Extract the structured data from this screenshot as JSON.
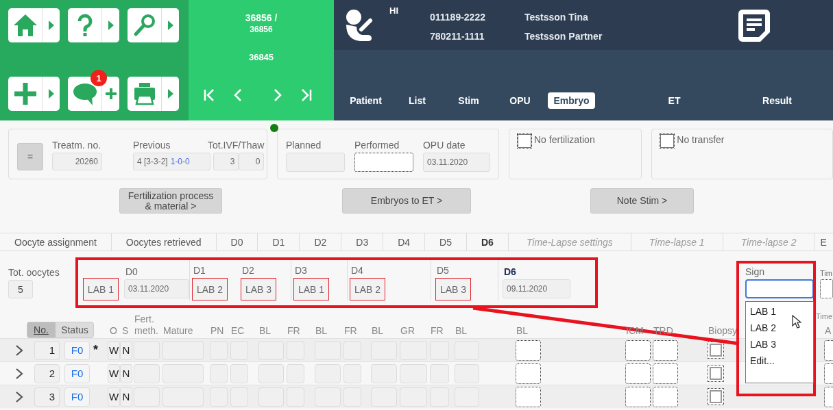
{
  "toolbar": {
    "buttons": [
      {
        "kind": "home",
        "has_menu": true,
        "quick_add": false
      },
      {
        "kind": "help",
        "has_menu": true,
        "quick_add": false
      },
      {
        "kind": "search",
        "has_menu": true,
        "quick_add": false
      },
      {
        "kind": "add",
        "has_menu": true,
        "quick_add": false
      },
      {
        "kind": "comment",
        "has_menu": false,
        "quick_add": true,
        "badge": "1"
      },
      {
        "kind": "print",
        "has_menu": true,
        "quick_add": false
      }
    ]
  },
  "record": {
    "current": "36856 /",
    "total": "36856",
    "previous": "36845",
    "nav": [
      {
        "kind": "first"
      },
      {
        "kind": "prev"
      },
      {
        "kind": "next"
      },
      {
        "kind": "last"
      }
    ]
  },
  "patient": {
    "badge": "HI",
    "people": [
      {
        "id": "011189-2222",
        "name": "Testsson Tina"
      },
      {
        "id": "780211-1111",
        "name": "Testsson Partner"
      }
    ]
  },
  "main_tabs": [
    {
      "label": "Patient",
      "selected": false
    },
    {
      "label": "List",
      "selected": false
    },
    {
      "label": "Stim",
      "selected": false
    },
    {
      "label": "OPU",
      "selected": false
    },
    {
      "label": "Embryo",
      "selected": true
    },
    {
      "label": "ET",
      "selected": false
    },
    {
      "label": "Result",
      "selected": false
    }
  ],
  "treatment": {
    "button": "=",
    "treatment_no": {
      "label": "Treatm. no.",
      "value": "20260"
    },
    "previous": {
      "label": "Previous",
      "value": "4 [3-3-2]",
      "outcome": "1-0-0"
    },
    "tot_ivf_thaw": {
      "label": "Tot.IVF/Thaw",
      "ivf": "3",
      "thaw": "0"
    }
  },
  "opu": [
    {
      "label": "Planned",
      "focused": false
    },
    {
      "label": "Performed",
      "focused": true
    },
    {
      "label": "OPU date",
      "value": "03.11.2020",
      "focused": false
    }
  ],
  "options": [
    {
      "label": "No fertilization",
      "checked": false
    },
    {
      "label": "No transfer",
      "checked": false
    }
  ],
  "actions": [
    "Fertilization process & material >",
    "Embryos to ET >",
    "Note Stim >"
  ],
  "sections": [
    {
      "label": "Oocyte assignment",
      "selected": false,
      "disabled": false
    },
    {
      "label": "Oocytes retrieved",
      "selected": false,
      "disabled": false
    },
    {
      "label": "D0",
      "selected": false,
      "disabled": false
    },
    {
      "label": "D1",
      "selected": false,
      "disabled": false
    },
    {
      "label": "D2",
      "selected": false,
      "disabled": false
    },
    {
      "label": "D3",
      "selected": false,
      "disabled": false
    },
    {
      "label": "D4",
      "selected": false,
      "disabled": false
    },
    {
      "label": "D5",
      "selected": false,
      "disabled": false
    },
    {
      "label": "D6",
      "selected": true,
      "disabled": false
    },
    {
      "label": "Time-Lapse settings",
      "selected": false,
      "disabled": true
    },
    {
      "label": "Time-lapse 1",
      "selected": false,
      "disabled": true
    },
    {
      "label": "Time-lapse 2",
      "selected": false,
      "disabled": true
    },
    {
      "label": "E",
      "selected": false,
      "disabled": false
    }
  ],
  "day_plan": {
    "total": {
      "label": "Tot. oocytes",
      "value": "5"
    },
    "days": [
      {
        "label": "D0",
        "lab": "LAB 1",
        "date": "03.11.2020",
        "current": false
      },
      {
        "label": "D1",
        "lab": "LAB 2",
        "current": false
      },
      {
        "label": "D2",
        "lab": "LAB 3",
        "current": false
      },
      {
        "label": "D3",
        "lab": "LAB 1",
        "current": false
      },
      {
        "label": "D4",
        "lab": "LAB 2",
        "current": false
      },
      {
        "label": "D5",
        "lab": "LAB 3",
        "current": false
      },
      {
        "label": "D6",
        "date": "09.11.2020",
        "current": true
      }
    ]
  },
  "sign": {
    "label": "Sign",
    "focused": true,
    "options": [
      "LAB 1",
      "LAB 2",
      "LAB 3",
      "Edit..."
    ]
  },
  "next_field": {
    "label": "Tim"
  },
  "next_column_label": "Time",
  "table": {
    "sort": [
      {
        "label": "No.",
        "selected": true
      },
      {
        "label": "Status",
        "selected": false
      }
    ],
    "columns": [
      "O",
      "S",
      "Fert. meth.",
      "Mature",
      "PN",
      "EC",
      "BL",
      "FR",
      "BL",
      "FR",
      "BL",
      "GR",
      "FR",
      "BL",
      "BL",
      "ICM",
      "TRD",
      "Biopsy",
      "A"
    ],
    "rows": [
      {
        "no": "1",
        "status": "F0",
        "flag": "*",
        "o": "W",
        "s": "N",
        "biopsy": false
      },
      {
        "no": "2",
        "status": "F0",
        "o": "W",
        "s": "N",
        "biopsy": false
      },
      {
        "no": "3",
        "status": "F0",
        "o": "W",
        "s": "N",
        "biopsy": false
      }
    ]
  }
}
